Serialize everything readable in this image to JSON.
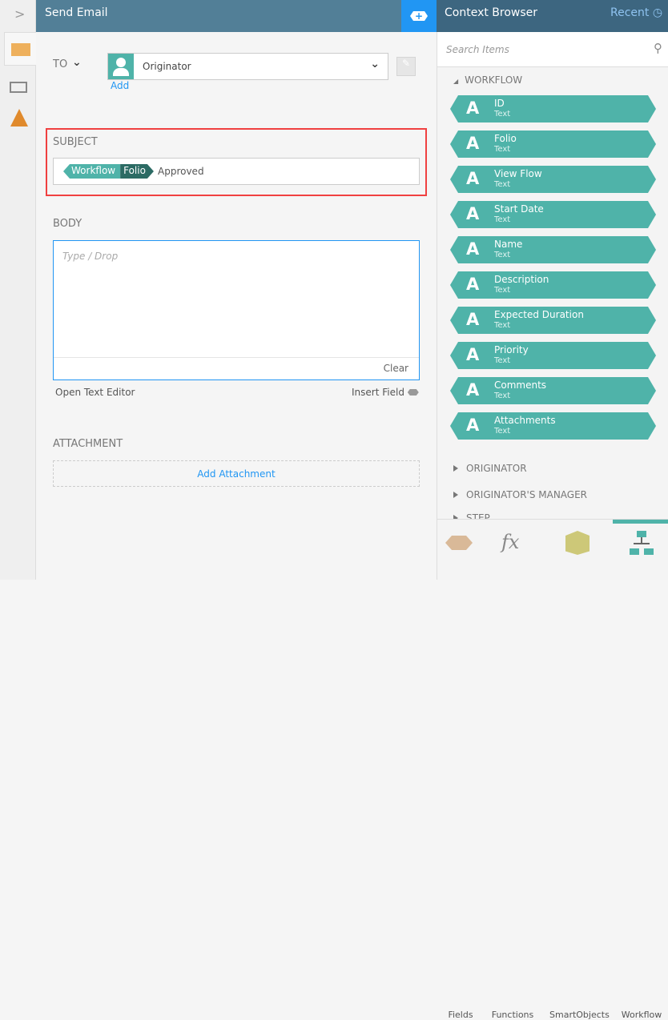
{
  "header": {
    "title": "Send Email"
  },
  "to": {
    "label": "TO",
    "value": "Originator",
    "add": "Add"
  },
  "subject": {
    "label": "SUBJECT",
    "token_group": "Workflow",
    "token_field": "Folio",
    "text": "Approved"
  },
  "body": {
    "label": "BODY",
    "placeholder": "Type / Drop",
    "clear": "Clear",
    "open_editor": "Open Text Editor",
    "insert_field": "Insert Field"
  },
  "attachment": {
    "label": "ATTACHMENT",
    "add": "Add Attachment"
  },
  "context": {
    "title": "Context Browser",
    "recent": "Recent",
    "search_placeholder": "Search Items",
    "workflow_label": "WORKFLOW",
    "items": [
      {
        "name": "ID",
        "type": "Text"
      },
      {
        "name": "Folio",
        "type": "Text"
      },
      {
        "name": "View Flow",
        "type": "Text"
      },
      {
        "name": "Start Date",
        "type": "Text"
      },
      {
        "name": "Name",
        "type": "Text"
      },
      {
        "name": "Description",
        "type": "Text"
      },
      {
        "name": "Expected Duration",
        "type": "Text"
      },
      {
        "name": "Priority",
        "type": "Text"
      },
      {
        "name": "Comments",
        "type": "Text"
      },
      {
        "name": "Attachments",
        "type": "Text"
      }
    ],
    "sections": [
      "ORIGINATOR",
      "ORIGINATOR'S MANAGER",
      "STEP"
    ],
    "tabs": [
      "Fields",
      "Functions",
      "SmartObjects",
      "Workflow"
    ]
  },
  "colors": {
    "header": "#527f97",
    "accent": "#2196f3",
    "teal": "#4fb3a9",
    "highlight": "#f04040"
  }
}
